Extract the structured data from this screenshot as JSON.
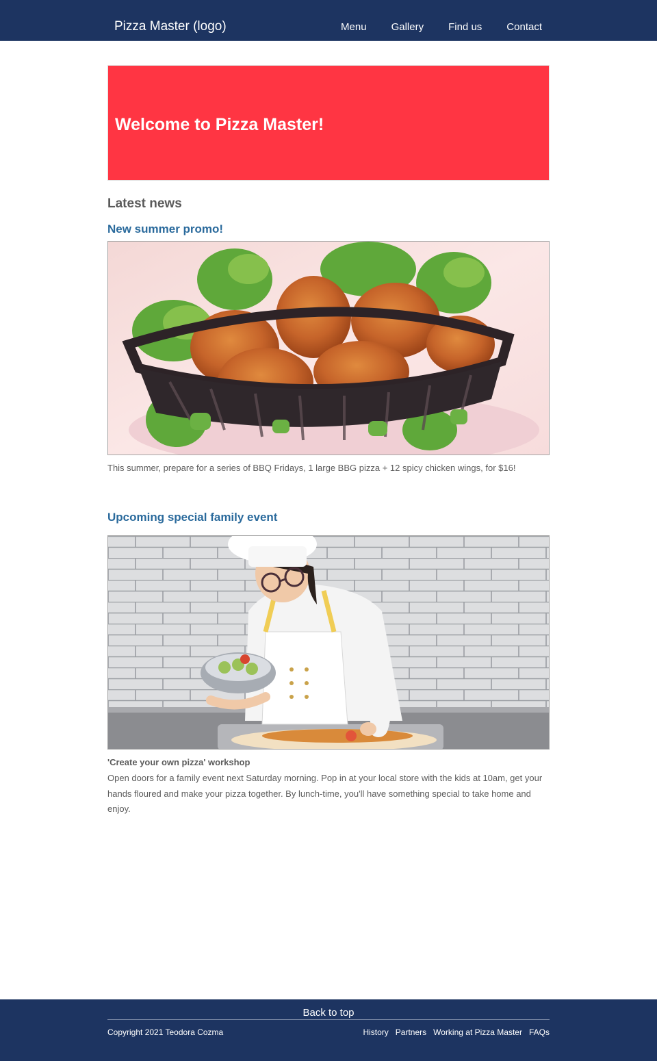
{
  "header": {
    "logo": "Pizza Master (logo)",
    "nav": [
      "Menu",
      "Gallery",
      "Find us",
      "Contact"
    ]
  },
  "hero": {
    "title": "Welcome to Pizza Master!"
  },
  "news": {
    "section_title": "Latest news",
    "items": [
      {
        "title": "New summer promo!",
        "text": "This summer, prepare for a series of BBQ Fridays, 1 large BBG pizza + 12 spicy chicken wings, for $16!"
      },
      {
        "title": "Upcoming special family event",
        "subtitle": "'Create your own pizza' workshop",
        "text": "Open doors for a family event next Saturday morning. Pop in at your local store with the kids at 10am, get your hands floured and make your pizza together. By lunch-time, you'll have something special to take home and enjoy."
      }
    ]
  },
  "footer": {
    "back_to_top": "Back to top",
    "copyright": "Copyright 2021 Teodora Cozma",
    "links": [
      "History",
      "Partners",
      "Working at Pizza Master",
      "FAQs"
    ]
  },
  "colors": {
    "navy": "#1d3461",
    "hero_red": "#ff3543",
    "link_blue": "#2a6a9c"
  }
}
